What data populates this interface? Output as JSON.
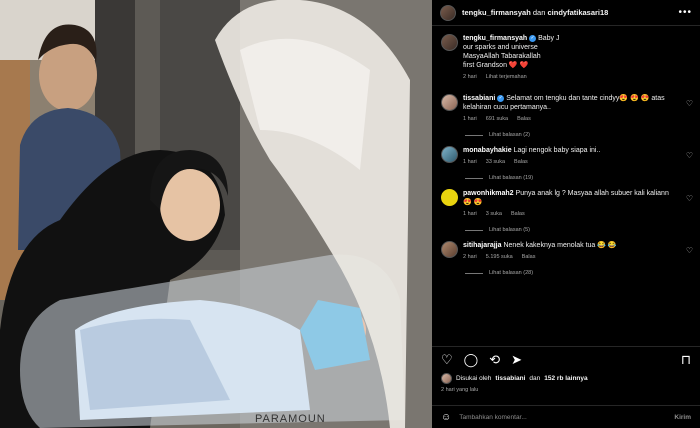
{
  "header": {
    "user1": "tengku_firmansyah",
    "and": "dan",
    "user2": "cindyfatikasari18",
    "more": "•••"
  },
  "caption": {
    "user": "tengku_firmansyah",
    "line1": "Baby J",
    "line2": "our sparks and universe",
    "line3": "MasyaAllah Tabarakallah",
    "line4": "first Grandson",
    "hearts": "❤️ ❤️",
    "time": "2 hari",
    "translate": "Lihat terjemahan"
  },
  "comments": [
    {
      "user": "tissabiani",
      "verified": true,
      "text": "Selamat om tengku dan tante cindyy😍 😍 😍 atas kelahiran cucu pertamanya..",
      "time": "1 hari",
      "likes": "691 suka",
      "reply": "Balas",
      "view_replies": "Lihat balasan (2)"
    },
    {
      "user": "monabayhakie",
      "verified": false,
      "text": "Lagi nengok baby siapa ini..",
      "time": "1 hari",
      "likes": "33 suka",
      "reply": "Balas",
      "view_replies": "Lihat balasan (19)"
    },
    {
      "user": "pawonhikmah2",
      "verified": false,
      "text": "Punya anak lg ? Masyaa allah subuer kali kaliann 😍 😍",
      "time": "1 hari",
      "likes": "3 suka",
      "reply": "Balas",
      "view_replies": "Lihat balasan (5)"
    },
    {
      "user": "sitihajarajja",
      "verified": false,
      "text": "Nenek kakeknya menolak tua 😂 😂",
      "time": "2 hari",
      "likes": "5.195 suka",
      "reply": "Balas",
      "view_replies": "Lihat balasan (28)"
    }
  ],
  "actions": {
    "liked_prefix": "Disukai oleh",
    "liked_user": "tissabiani",
    "liked_mid": "dan",
    "liked_count": "152 rb lainnya",
    "time": "2 hari yang lalu"
  },
  "add_comment": {
    "placeholder": "Tambahkan komentar...",
    "send": "Kirim"
  },
  "photo": {
    "brand_text": "PARAMOUN"
  },
  "colors": {
    "background": "#000000",
    "text": "#f5f5f5",
    "muted": "#a8a8a8",
    "verified": "#3897f0"
  }
}
